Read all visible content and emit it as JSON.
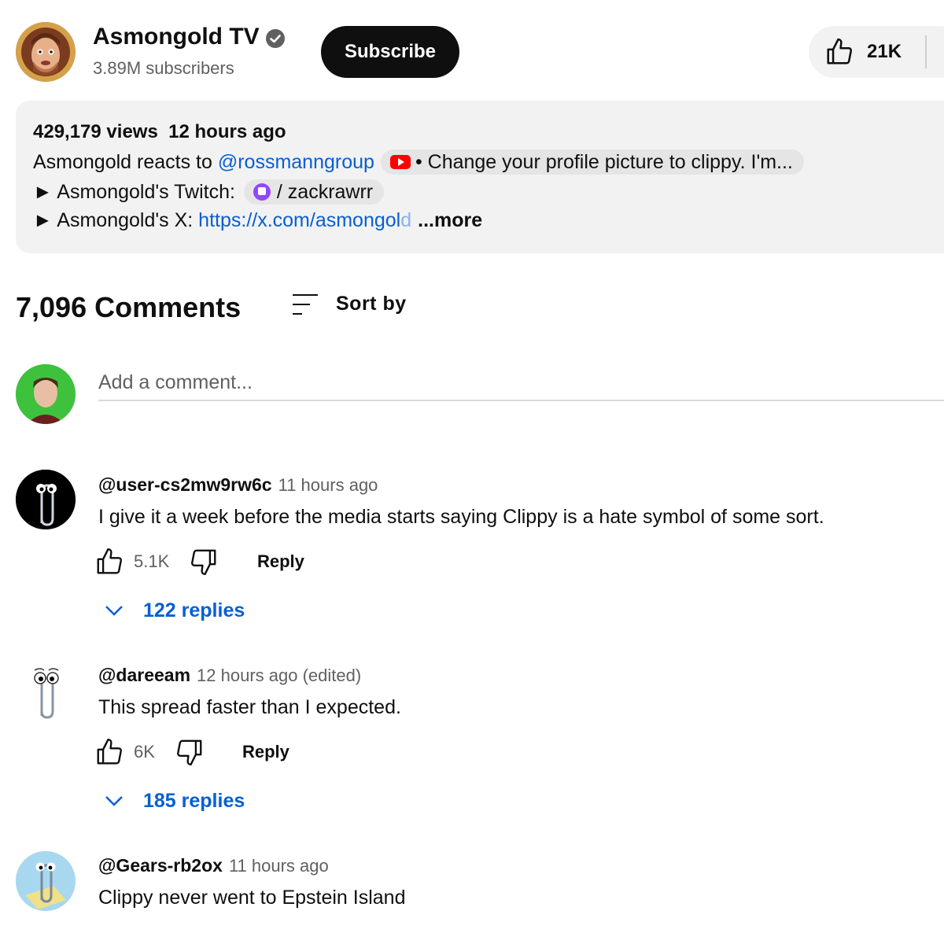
{
  "channel": {
    "name": "Asmongold TV",
    "subscribers": "3.89M subscribers",
    "subscribe_label": "Subscribe",
    "likes": "21K"
  },
  "description": {
    "views": "429,179 views",
    "posted": "12 hours ago",
    "line1_prefix": "Asmongold reacts to ",
    "line1_link": "@rossmanngroup",
    "line1_chip": "• Change your profile picture to clippy. I'm...",
    "line2_prefix": "► Asmongold's Twitch: ",
    "line2_chip": "/ zackrawrr",
    "line3_prefix": "► Asmongold's X: ",
    "line3_link": "https://x.com/asmongol",
    "line3_link_fade": "d",
    "more_label": "...more"
  },
  "comments_header": {
    "count": "7,096 Comments",
    "sort_label": "Sort by"
  },
  "add_comment": {
    "placeholder": "Add a comment..."
  },
  "comments": [
    {
      "author": "@user-cs2mw9rw6c",
      "time": "11 hours ago",
      "text": "I give it a week before the media starts saying Clippy is a hate symbol of some sort.",
      "likes": "5.1K",
      "reply_label": "Reply",
      "replies": "122 replies"
    },
    {
      "author": "@dareeam",
      "time": "12 hours ago (edited)",
      "text": "This spread faster than I expected.",
      "likes": "6K",
      "reply_label": "Reply",
      "replies": "185 replies"
    },
    {
      "author": "@Gears-rb2ox",
      "time": "11 hours ago",
      "text": "Clippy never went to Epstein Island"
    }
  ]
}
